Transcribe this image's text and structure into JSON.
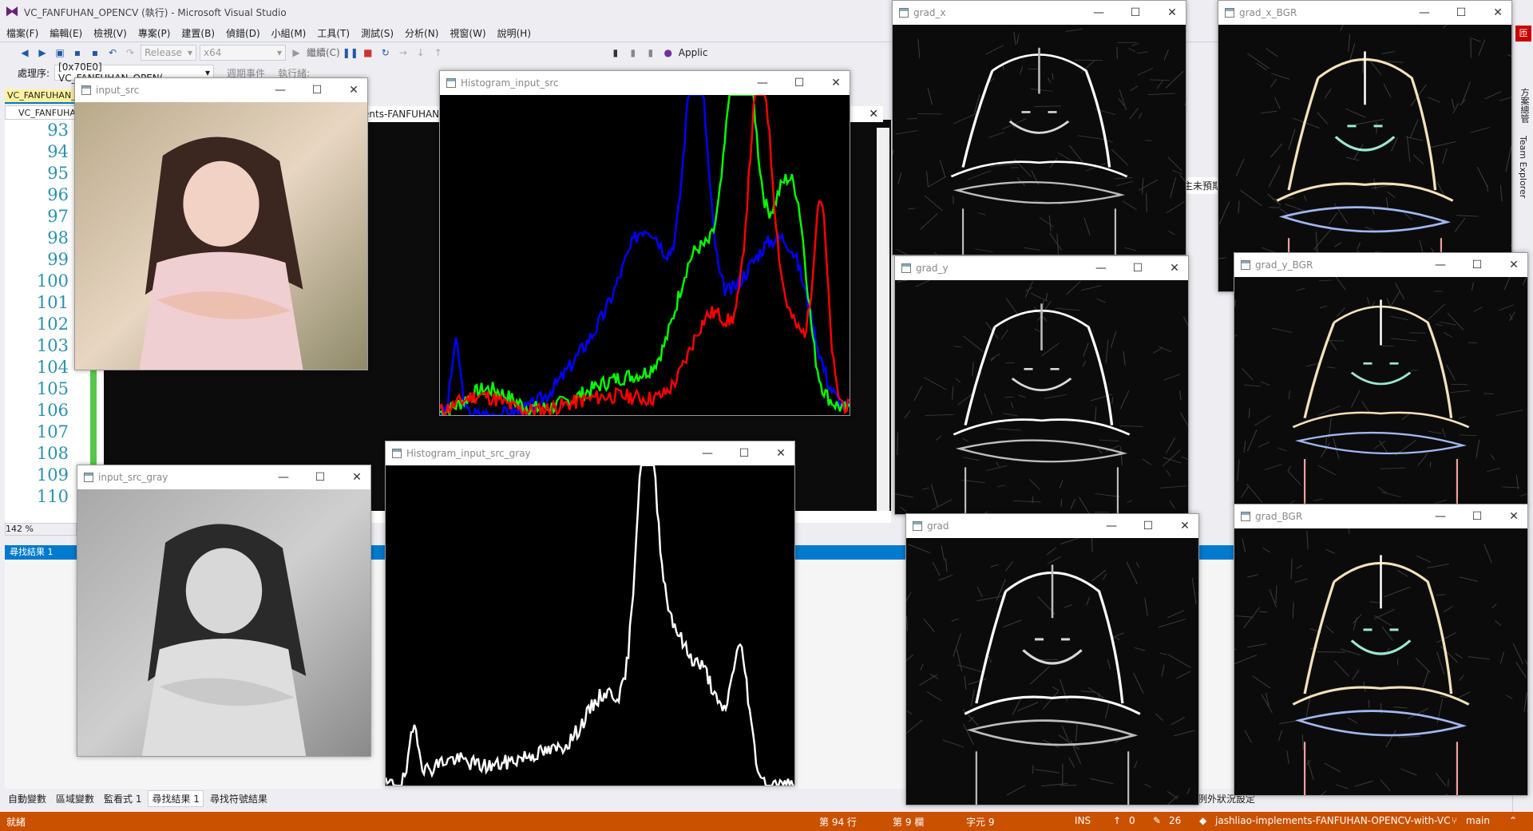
{
  "vs": {
    "title": "VC_FANFUHAN_OPENCV (執行) - Microsoft Visual Studio",
    "menu": [
      "檔案(F)",
      "編輯(E)",
      "檢視(V)",
      "專案(P)",
      "建置(B)",
      "偵錯(D)",
      "小組(M)",
      "工具(T)",
      "測試(S)",
      "分析(N)",
      "視窗(W)",
      "說明(H)"
    ],
    "toolbar": {
      "config": "Release",
      "platform": "x64",
      "continue": "繼續(C)",
      "app": "Applic"
    },
    "toolbar2": {
      "process_label": "處理序:",
      "process_value": "[0x70E0] VC_FANFUHAN_OPEN(",
      "lifecycle": "週期事件",
      "thread_label": "執行緒:"
    },
    "doc_tab": "VC_FANFUHAN_OPENCV",
    "doc_tab2": "VC_FANFUHAN_OPENCV",
    "console_title": "ents-FANFUHAN",
    "line_numbers": [
      "93",
      "94",
      "95",
      "96",
      "97",
      "98",
      "99",
      "100",
      "101",
      "102",
      "103",
      "104",
      "105",
      "106",
      "107",
      "108",
      "109",
      "110"
    ],
    "zoom": "142 %",
    "find_panel_title": "尋找結果 1",
    "side_text": "主未預期",
    "bottom_tabs": [
      {
        "label": "自動變數",
        "active": false
      },
      {
        "label": "區域變數",
        "active": false
      },
      {
        "label": "監看式 1",
        "active": false
      },
      {
        "label": "尋找結果 1",
        "active": true
      },
      {
        "label": "尋找符號結果",
        "active": false
      }
    ],
    "status": {
      "ready": "就緒",
      "line": "第 94 行",
      "col": "第 9 欄",
      "char": "字元 9",
      "ins": "INS",
      "up": "0",
      "edits": "26",
      "repo": "jashliao-implements-FANFUHAN-OPENCV-with-VC",
      "branch": "main"
    },
    "right_rail": {
      "solution": "方案總管",
      "team": "Team Explorer"
    },
    "right_tabs_text": "例外狀況設定",
    "badge": "匝"
  },
  "windows": [
    {
      "id": "input_src",
      "title": "input_src",
      "kind": "photo-color"
    },
    {
      "id": "input_src_gray",
      "title": "input_src_gray",
      "kind": "photo-gray"
    },
    {
      "id": "hist_src",
      "title": "Histogram_input_src",
      "kind": "hist-rgb"
    },
    {
      "id": "hist_gray",
      "title": "Histogram_input_src_gray",
      "kind": "hist-gray"
    },
    {
      "id": "grad_x",
      "title": "grad_x",
      "kind": "edge"
    },
    {
      "id": "grad_x_BGR",
      "title": "grad_x_BGR",
      "kind": "edge-color"
    },
    {
      "id": "grad_y",
      "title": "grad_y",
      "kind": "edge"
    },
    {
      "id": "grad_y_BGR",
      "title": "grad_y_BGR",
      "kind": "edge-color"
    },
    {
      "id": "grad",
      "title": "grad",
      "kind": "edge"
    },
    {
      "id": "grad_BGR",
      "title": "grad_BGR",
      "kind": "edge-color"
    }
  ],
  "icons": [
    "vs-logo-icon",
    "window-app-icon",
    "minimize-icon",
    "maximize-icon",
    "close-icon",
    "git-branch-icon",
    "pencil-icon",
    "arrow-up-icon"
  ]
}
